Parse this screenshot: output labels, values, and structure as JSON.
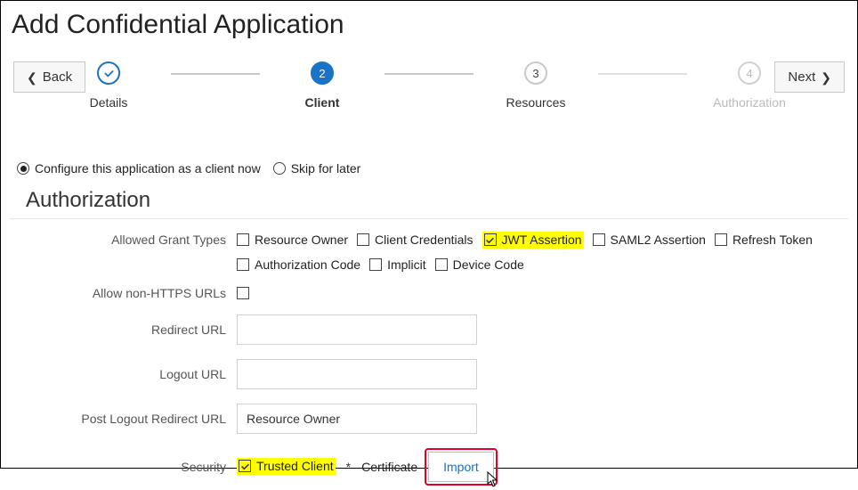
{
  "title": "Add Confidential Application",
  "nav": {
    "back": "Back",
    "next": "Next"
  },
  "wizard": {
    "step1": {
      "label": "Details"
    },
    "step2": {
      "num": "2",
      "label": "Client"
    },
    "step3": {
      "num": "3",
      "label": "Resources"
    },
    "step4": {
      "num": "4",
      "label": "Authorization"
    }
  },
  "configRadios": {
    "now": "Configure this application as a client now",
    "later": "Skip for later"
  },
  "section": "Authorization",
  "labels": {
    "grantTypes": "Allowed Grant Types",
    "nonHttps": "Allow non-HTTPS URLs",
    "redirect": "Redirect URL",
    "logout": "Logout URL",
    "postLogout": "Post Logout Redirect URL",
    "security": "Security"
  },
  "grantTypes": {
    "resourceOwner": "Resource Owner",
    "clientCreds": "Client Credentials",
    "jwt": "JWT Assertion",
    "saml2": "SAML2 Assertion",
    "refresh": "Refresh Token",
    "authCode": "Authorization Code",
    "implicit": "Implicit",
    "device": "Device Code"
  },
  "postLogoutValue": "Resource Owner",
  "security": {
    "trusted": "Trusted Client",
    "certificate": "Certificate",
    "import": "Import"
  },
  "colors": {
    "accent": "#1b73c7",
    "highlight": "#ffff00",
    "callout": "#e4002b"
  }
}
